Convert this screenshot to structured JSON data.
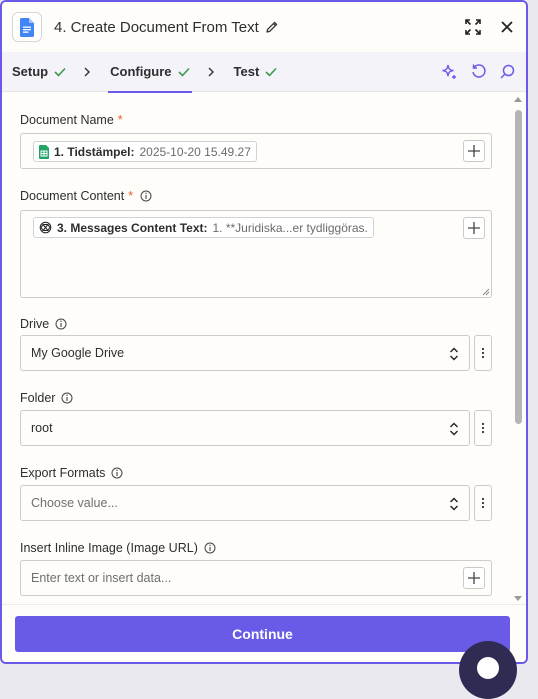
{
  "header": {
    "title": "4. Create Document From Text"
  },
  "tabs": [
    {
      "label": "Setup",
      "done": true
    },
    {
      "label": "Configure",
      "done": true,
      "active": true
    },
    {
      "label": "Test",
      "done": true
    }
  ],
  "fields": {
    "document_name": {
      "label": "Document Name",
      "required_mark": "*",
      "pill_label": "1. Tidstämpel:",
      "pill_value": "2025-10-20 15.49.27"
    },
    "document_content": {
      "label": "Document Content",
      "required_mark": "*",
      "pill_label": "3. Messages Content Text:",
      "pill_value": "1. **Juridiska...er tydliggöras."
    },
    "drive": {
      "label": "Drive",
      "value": "My Google Drive"
    },
    "folder": {
      "label": "Folder",
      "value": "root"
    },
    "export_formats": {
      "label": "Export Formats",
      "placeholder": "Choose value..."
    },
    "inline_image": {
      "label": "Insert Inline Image (Image URL)",
      "placeholder": "Enter text or insert data..."
    }
  },
  "footer": {
    "continue_label": "Continue"
  },
  "colors": {
    "accent": "#695be8",
    "check": "#3d9a4b",
    "required": "#e8582a",
    "sheets_green": "#21a464",
    "docs_blue": "#4285f4"
  },
  "icons": [
    "google-docs-icon",
    "pencil-icon",
    "expand-icon",
    "close-icon",
    "check-icon",
    "chevron-right-icon",
    "sparkle-icon",
    "undo-icon",
    "search-icon",
    "info-icon",
    "plus-icon",
    "updown-icon",
    "kebab-icon",
    "google-sheets-icon",
    "openai-icon"
  ]
}
